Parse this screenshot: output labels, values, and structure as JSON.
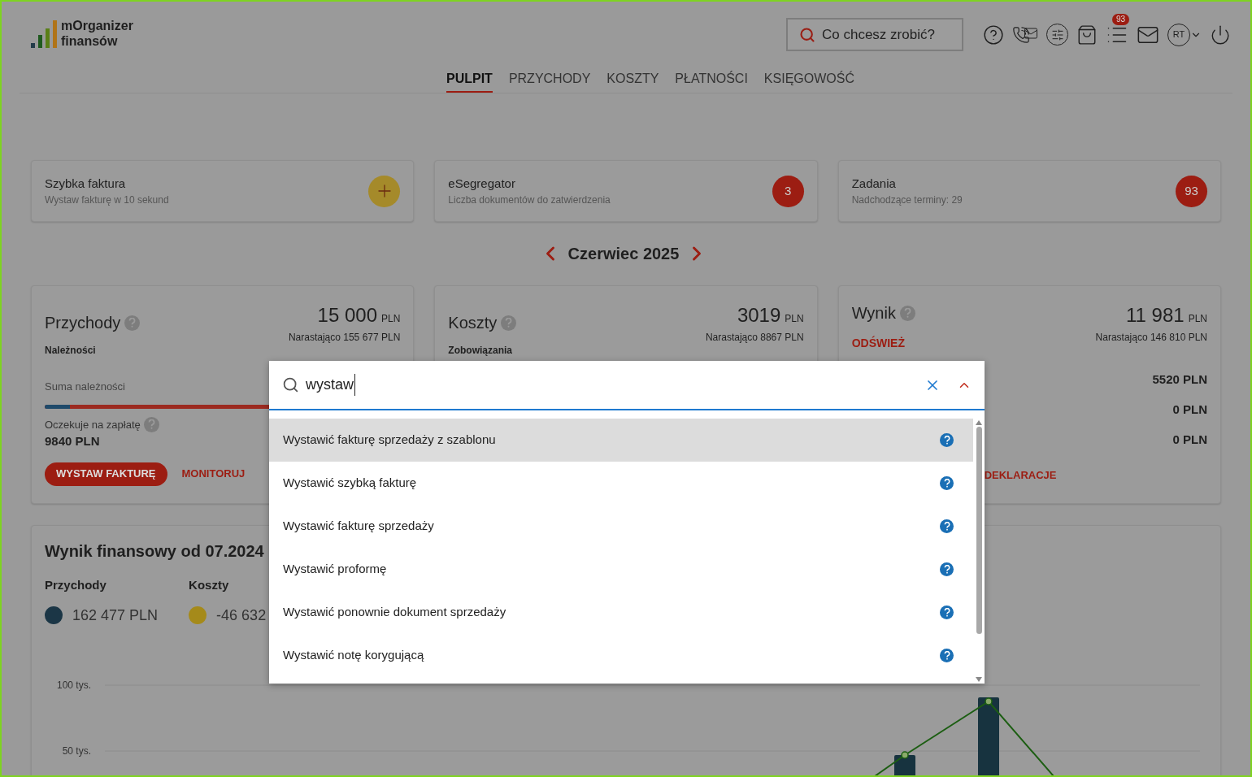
{
  "logo": {
    "line1": "mOrganizer",
    "line2": "finansów"
  },
  "search": {
    "placeholder": "Co chcesz zrobić?"
  },
  "toolbar": {
    "notifications_badge": "93",
    "avatar": "RT"
  },
  "tabs": [
    {
      "label": "PULPIT",
      "selected": true
    },
    {
      "label": "PRZYCHODY",
      "selected": false
    },
    {
      "label": "KOSZTY",
      "selected": false
    },
    {
      "label": "PŁATNOŚCI",
      "selected": false
    },
    {
      "label": "KSIĘGOWOŚĆ",
      "selected": false
    }
  ],
  "tiles": [
    {
      "kind": "add",
      "title": "Szybka faktura",
      "subtitle": "Wystaw fakturę w 10 sekund"
    },
    {
      "kind": "count",
      "title": "eSegregator",
      "subtitle": "Liczba dokumentów do zatwierdzenia",
      "badge": "3"
    },
    {
      "kind": "count",
      "title": "Zadania",
      "subtitle": "Nadchodzące terminy: 29",
      "badge": "93"
    }
  ],
  "month": "Czerwiec 2025",
  "income": {
    "title": "Przychody",
    "amount": "15 000",
    "currency": "PLN",
    "cumulative": "Narastająco 155 677 PLN",
    "section": "Należności",
    "sum_label": "Suma należności",
    "level": 0.07,
    "waiting_label": "Oczekuje na zapłatę",
    "waiting_value": "9840 PLN",
    "primary_button": "WYSTAW FAKTURĘ",
    "link": "MONITORUJ"
  },
  "costs": {
    "title": "Koszty",
    "amount": "3019",
    "currency": "PLN",
    "cumulative": "Narastająco 8867 PLN",
    "section": "Zobowiązania"
  },
  "result": {
    "title": "Wynik",
    "amount": "11 981",
    "currency": "PLN",
    "cumulative": "Narastająco 146 810 PLN",
    "refresh": "ODŚWIEŻ",
    "values": [
      "5520 PLN",
      "0 PLN",
      "0 PLN"
    ],
    "link": "DEKLARACJE"
  },
  "finance": {
    "title": "Wynik finansowy od 07.2024",
    "legend": [
      {
        "label": "Przychody",
        "value": "162 477 PLN",
        "color": "#1b3646"
      },
      {
        "label": "Koszty",
        "value": "-46 632",
        "color": "#a58a1a"
      }
    ],
    "axis_labels": [
      "100 tys.",
      "50 tys."
    ]
  },
  "dropdown": {
    "query": "wystaw",
    "results": [
      {
        "label": "Wystawić fakturę sprzedaży z szablonu",
        "selected": true
      },
      {
        "label": "Wystawić szybką fakturę",
        "selected": false
      },
      {
        "label": "Wystawić fakturę sprzedaży",
        "selected": false
      },
      {
        "label": "Wystawić proformę",
        "selected": false
      },
      {
        "label": "Wystawić ponownie dokument sprzedaży",
        "selected": false
      },
      {
        "label": "Wystawić notę korygującą",
        "selected": false
      }
    ]
  }
}
